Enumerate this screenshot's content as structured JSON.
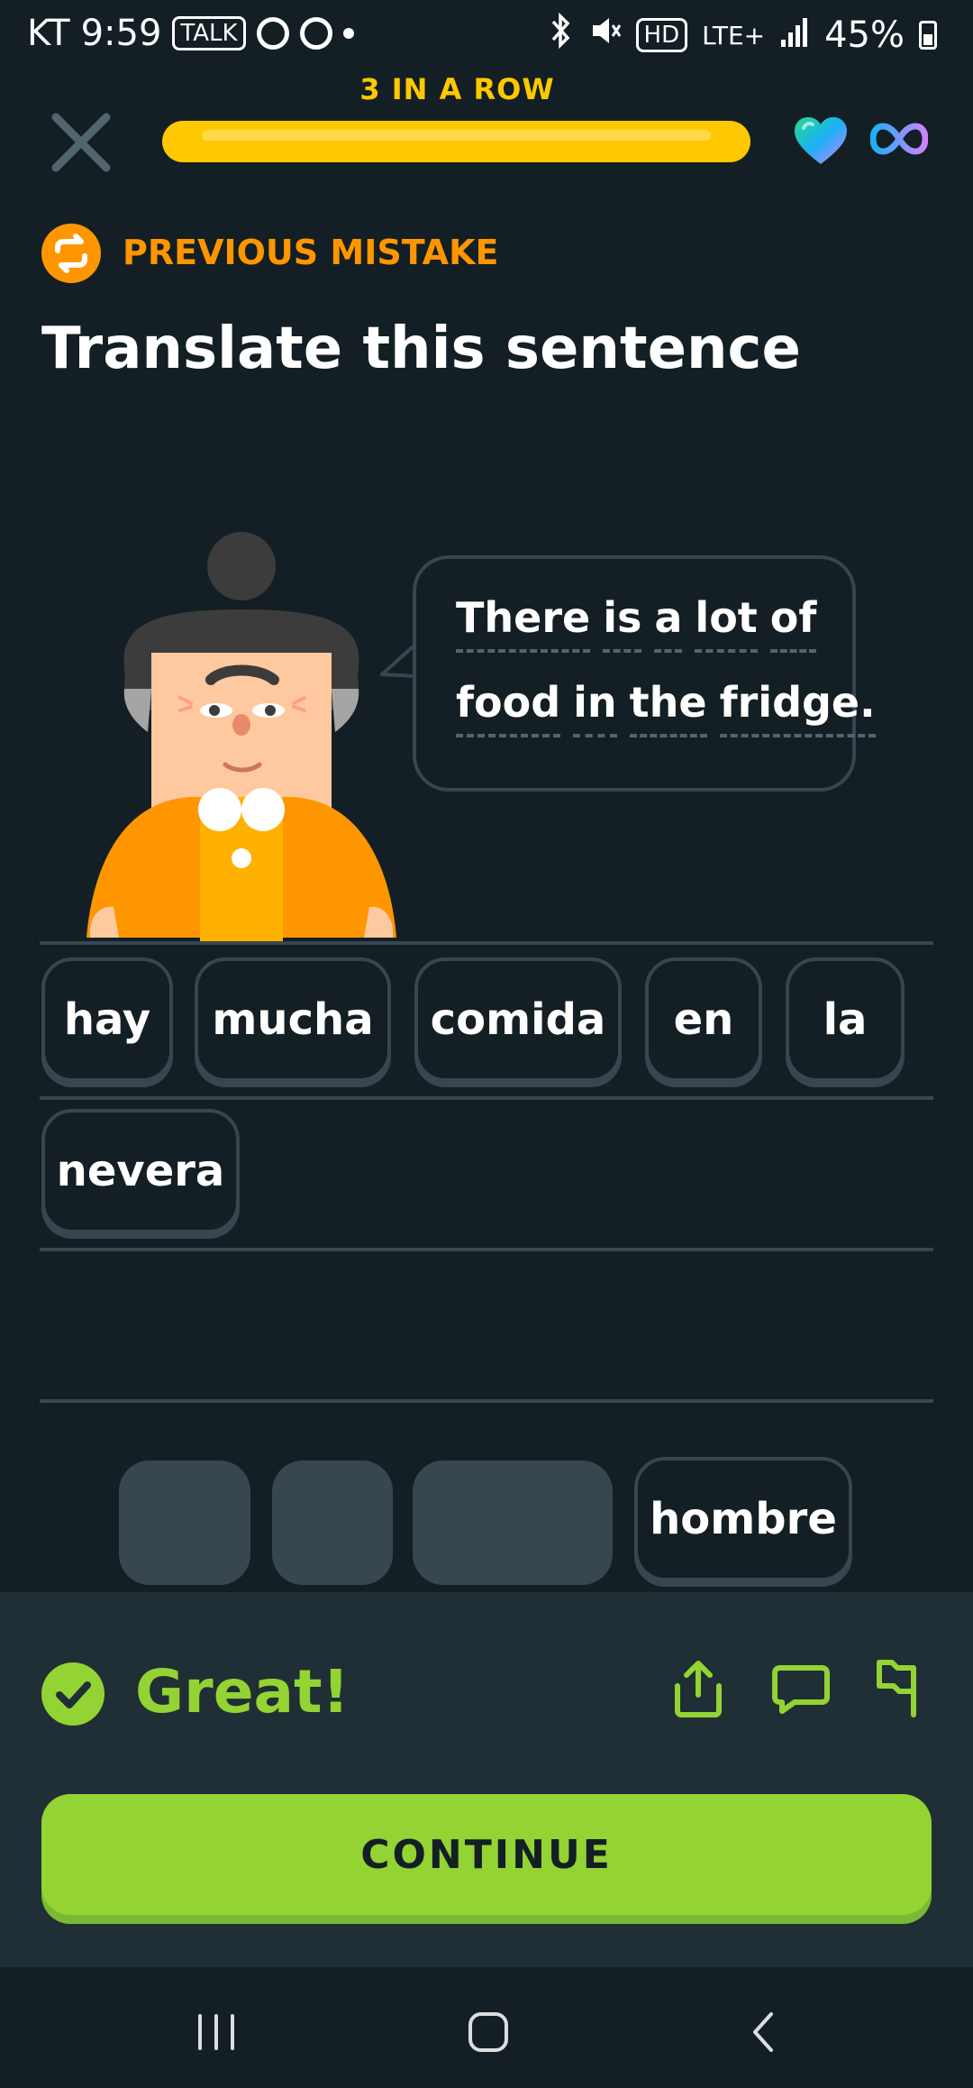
{
  "status_bar": {
    "carrier": "KT",
    "time": "9:59",
    "talk_badge": "TALK",
    "hd_badge": "HD",
    "network": "LTE+",
    "battery": "45%",
    "icons": [
      "talk-icon",
      "c-icon",
      "c-icon",
      "dot-icon",
      "bluetooth-icon",
      "mute-icon",
      "hd-icon",
      "signal-icon",
      "battery-icon"
    ]
  },
  "header": {
    "streak_label": "3 IN A ROW",
    "progress": 1.0,
    "progress_color": "#ffc800"
  },
  "prompt": {
    "badge_label": "PREVIOUS MISTAKE",
    "title": "Translate this sentence"
  },
  "sentence": {
    "line1": [
      "There",
      "is",
      "a",
      "lot",
      "of"
    ],
    "line2": [
      "food",
      "in",
      "the",
      "fridge."
    ]
  },
  "answer_tiles": [
    "hay",
    "mucha",
    "comida",
    "en",
    "la",
    "nevera"
  ],
  "word_bank": {
    "remaining": [
      "hombre"
    ]
  },
  "feedback": {
    "label": "Great!",
    "color": "#93d333",
    "continue_label": "CONTINUE"
  }
}
